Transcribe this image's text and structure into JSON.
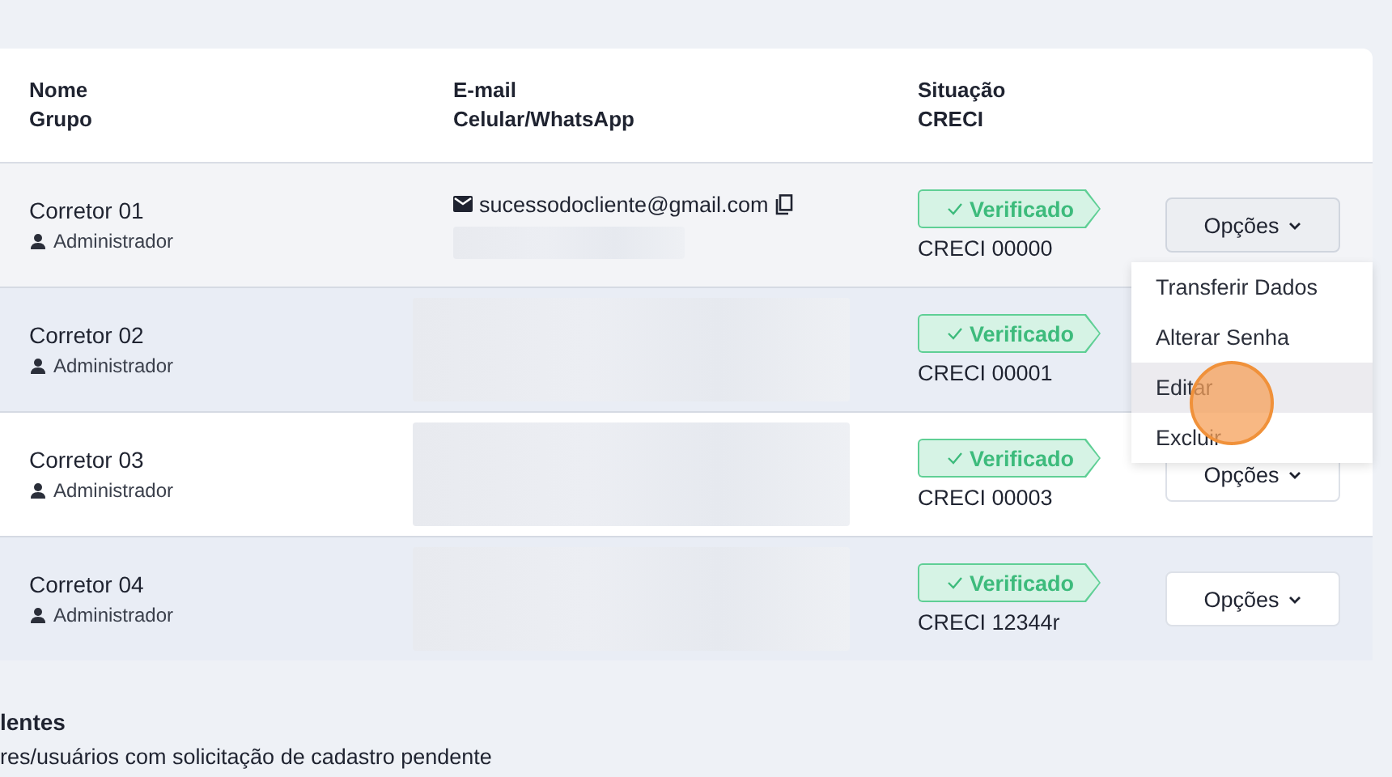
{
  "table": {
    "columns": [
      {
        "line1": "Nome",
        "line2": "Grupo"
      },
      {
        "line1": "E-mail",
        "line2": "Celular/WhatsApp"
      },
      {
        "line1": "Situação",
        "line2": "CRECI"
      }
    ],
    "rows": [
      {
        "name": "Corretor 01",
        "group": "Administrador",
        "email": "sucessodocliente@gmail.com",
        "status": "Verificado",
        "creci": "CRECI 00000",
        "button": "Opções",
        "menu_open": true
      },
      {
        "name": "Corretor 02",
        "group": "Administrador",
        "status": "Verificado",
        "creci": "CRECI 00001",
        "menu_open": false
      },
      {
        "name": "Corretor 03",
        "group": "Administrador",
        "status": "Verificado",
        "creci": "CRECI 00003",
        "button": "Opções",
        "menu_open": false
      },
      {
        "name": "Corretor 04",
        "group": "Administrador",
        "status": "Verificado",
        "creci": "CRECI 12344r",
        "button": "Opções",
        "menu_open": false
      }
    ]
  },
  "menu": {
    "items": [
      {
        "label": "Transferir Dados",
        "selected": false
      },
      {
        "label": "Alterar Senha",
        "selected": false
      },
      {
        "label": "Editar",
        "selected": true
      },
      {
        "label": "Excluir",
        "selected": false
      }
    ]
  },
  "pending": {
    "title": "lentes",
    "subtitle": "res/usuários com solicitação de cadastro pendente"
  }
}
